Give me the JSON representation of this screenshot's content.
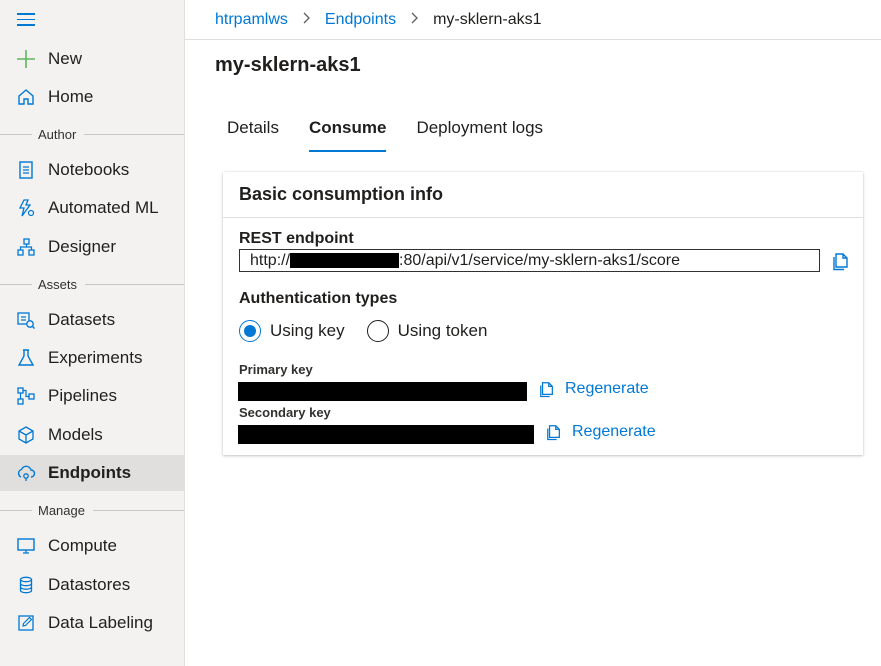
{
  "sidebar": {
    "items": [
      {
        "key": "new",
        "label": "New",
        "icon": "plus-icon"
      },
      {
        "key": "home",
        "label": "Home",
        "icon": "home-icon"
      },
      {
        "key": "notebooks",
        "label": "Notebooks",
        "icon": "notebook-icon"
      },
      {
        "key": "automated-ml",
        "label": "Automated ML",
        "icon": "automl-icon"
      },
      {
        "key": "designer",
        "label": "Designer",
        "icon": "designer-icon"
      },
      {
        "key": "datasets",
        "label": "Datasets",
        "icon": "datasets-icon"
      },
      {
        "key": "experiments",
        "label": "Experiments",
        "icon": "flask-icon"
      },
      {
        "key": "pipelines",
        "label": "Pipelines",
        "icon": "pipeline-icon"
      },
      {
        "key": "models",
        "label": "Models",
        "icon": "cube-icon"
      },
      {
        "key": "endpoints",
        "label": "Endpoints",
        "icon": "endpoint-cloud-icon"
      },
      {
        "key": "compute",
        "label": "Compute",
        "icon": "monitor-icon"
      },
      {
        "key": "datastores",
        "label": "Datastores",
        "icon": "database-icon"
      },
      {
        "key": "data-labeling",
        "label": "Data Labeling",
        "icon": "edit-icon"
      }
    ],
    "sections": {
      "author": "Author",
      "assets": "Assets",
      "manage": "Manage"
    },
    "active": "endpoints"
  },
  "breadcrumb": {
    "workspace": "htrpamlws",
    "section": "Endpoints",
    "current": "my-sklern-aks1"
  },
  "page": {
    "title": "my-sklern-aks1"
  },
  "tabs": [
    {
      "label": "Details",
      "active": false
    },
    {
      "label": "Consume",
      "active": true
    },
    {
      "label": "Deployment logs",
      "active": false
    }
  ],
  "card": {
    "title": "Basic consumption info",
    "rest_endpoint_label": "REST endpoint",
    "endpoint_prefix": "http://",
    "endpoint_suffix": ":80/api/v1/service/my-sklern-aks1/score",
    "auth_label": "Authentication types",
    "auth_options": [
      {
        "label": "Using key",
        "selected": true
      },
      {
        "label": "Using token",
        "selected": false
      }
    ],
    "primary_key_label": "Primary key",
    "secondary_key_label": "Secondary key",
    "regenerate_label": "Regenerate"
  },
  "colors": {
    "accent": "#0078d4",
    "new_icon": "#5cb85c",
    "sidebar_bg": "#f3f2f1"
  }
}
